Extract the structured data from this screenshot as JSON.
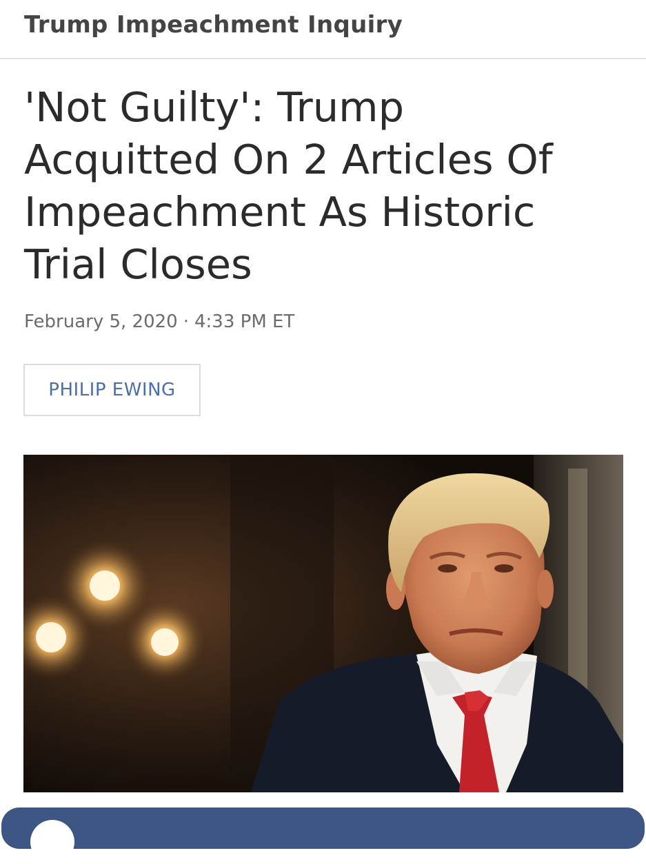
{
  "section": {
    "label": "Trump Impeachment Inquiry"
  },
  "article": {
    "headline": "'Not Guilty': Trump Acquitted On 2 Articles Of Impeachment As Historic Trial Closes",
    "date": "February 5, 2020",
    "separator": "·",
    "time": "4:33 PM ET",
    "author": "PHILIP EWING"
  },
  "colors": {
    "byline": "#4a6fa8",
    "bottom_bar": "#3e5683",
    "divider": "#e4e4e4"
  },
  "icons": {
    "bottom_circle": "avatar-circle-icon"
  }
}
